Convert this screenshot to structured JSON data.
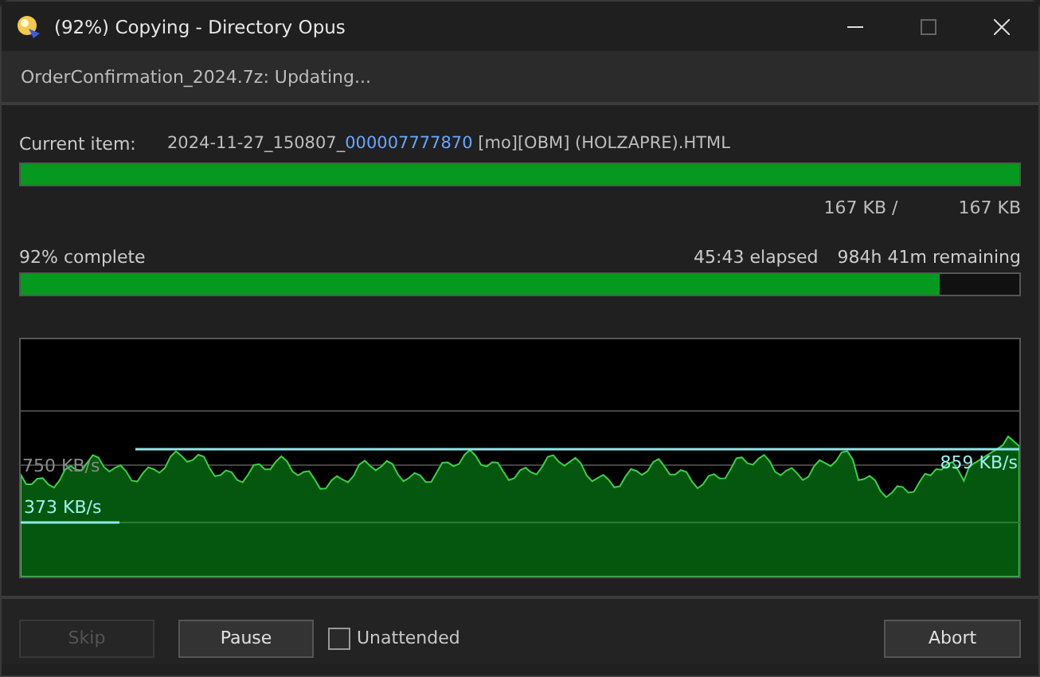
{
  "window": {
    "title": "(92%) Copying - Directory Opus"
  },
  "operation": "OrderConfirmation_2024.7z: Updating...",
  "current_item": {
    "label": "Current item:",
    "value_parts": [
      {
        "text": "2024-11-27_150807_",
        "highlight": false
      },
      {
        "text": "000007777870",
        "highlight": true
      },
      {
        "text": " [mo][OBM] (HOLZAPRE).HTML",
        "highlight": false
      }
    ]
  },
  "file_progress": {
    "level": 1.0,
    "done": "167 KB /",
    "total": "167 KB"
  },
  "total_progress": {
    "complete": "92% complete",
    "elapsed": "45:43 elapsed",
    "remaining": "984h 41m remaining",
    "level": 0.92
  },
  "speed_graph": {
    "labels": [
      {
        "text": "750 KB/s",
        "kind": "scale"
      },
      {
        "text": "373 KB/s",
        "kind": "average"
      },
      {
        "text": "859 KB/s",
        "kind": "current"
      }
    ]
  },
  "buttons": [
    {
      "label": "Skip",
      "disabled": true
    },
    {
      "label": "Pause",
      "disabled": false
    }
  ],
  "unattended": {
    "label": "Unattended",
    "checked": false
  },
  "abort": {
    "label": "Abort",
    "disabled": false
  }
}
